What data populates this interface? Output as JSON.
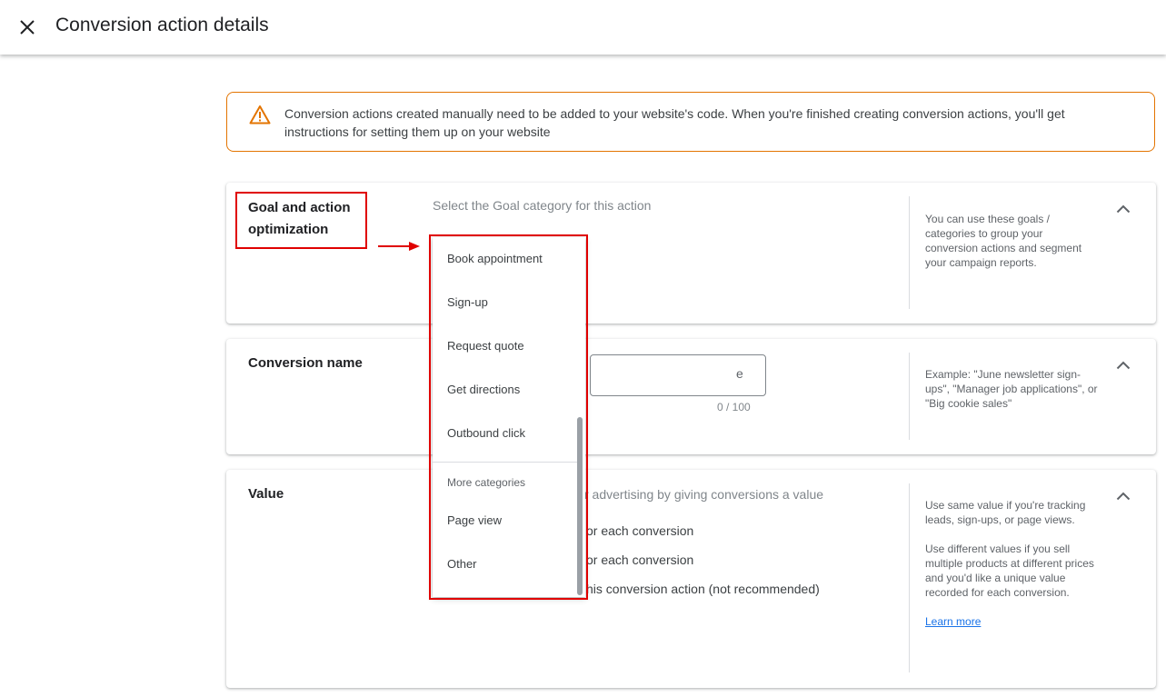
{
  "header": {
    "title": "Conversion action details",
    "close_icon": "close-icon"
  },
  "notice": {
    "icon": "warning-icon",
    "text": "Conversion actions created manually need to be added to your website's code. When you're finished creating conversion actions, you'll get instructions for setting them up on your website"
  },
  "goal_card": {
    "title_line1": "Goal and action",
    "title_line2": "optimization",
    "prompt": "Select the Goal category for this action",
    "help": "You can use these goals / categories to group your conversion actions and segment your campaign reports."
  },
  "name_card": {
    "title": "Conversion name",
    "input_value_visible": "e",
    "counter": "0 / 100",
    "help": "Example: \"June newsletter sign-ups\", \"Manager job applications\", or \"Big cookie sales\""
  },
  "value_card": {
    "title": "Value",
    "prompt_visible": "r advertising by giving conversions a value",
    "options_visible": [
      "or each conversion",
      "or each conversion",
      "his conversion action (not recommended)"
    ],
    "help_para1": "Use same value if you're tracking leads, sign-ups, or page views.",
    "help_para2": "Use different values if you sell multiple products at different prices and you'd like a unique value recorded for each conversion.",
    "learn_more": "Learn more"
  },
  "dropdown": {
    "items": [
      "Book appointment",
      "Sign-up",
      "Request quote",
      "Get directions",
      "Outbound click"
    ],
    "more_heading": "More categories",
    "more_items": [
      "Page view",
      "Other"
    ]
  },
  "colors": {
    "annotation_red": "#e00000",
    "warning_orange": "#e37400",
    "link_blue": "#1a73e8"
  }
}
